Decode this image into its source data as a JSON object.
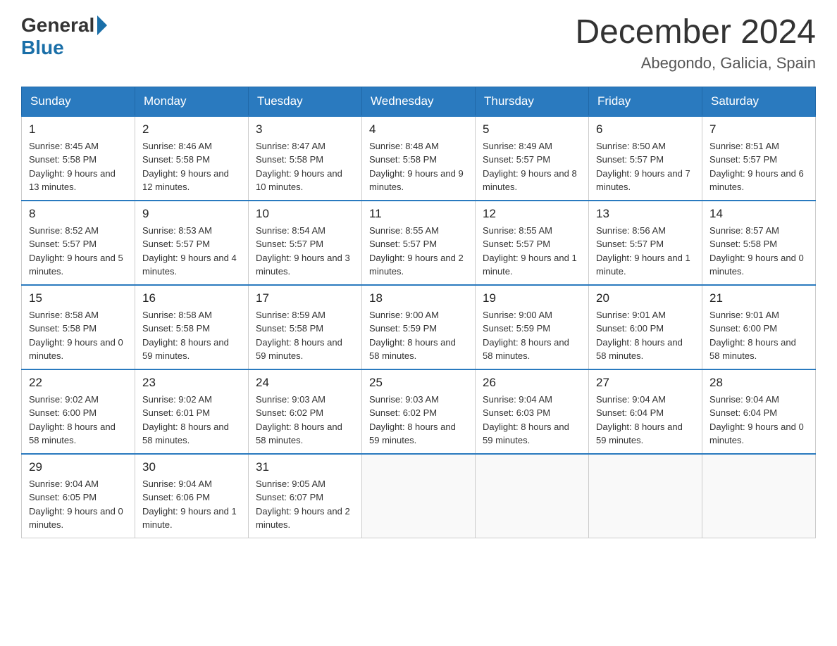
{
  "header": {
    "logo_general": "General",
    "logo_blue": "Blue",
    "month_title": "December 2024",
    "location": "Abegondo, Galicia, Spain"
  },
  "days_of_week": [
    "Sunday",
    "Monday",
    "Tuesday",
    "Wednesday",
    "Thursday",
    "Friday",
    "Saturday"
  ],
  "weeks": [
    [
      {
        "day": "1",
        "sunrise": "Sunrise: 8:45 AM",
        "sunset": "Sunset: 5:58 PM",
        "daylight": "Daylight: 9 hours and 13 minutes."
      },
      {
        "day": "2",
        "sunrise": "Sunrise: 8:46 AM",
        "sunset": "Sunset: 5:58 PM",
        "daylight": "Daylight: 9 hours and 12 minutes."
      },
      {
        "day": "3",
        "sunrise": "Sunrise: 8:47 AM",
        "sunset": "Sunset: 5:58 PM",
        "daylight": "Daylight: 9 hours and 10 minutes."
      },
      {
        "day": "4",
        "sunrise": "Sunrise: 8:48 AM",
        "sunset": "Sunset: 5:58 PM",
        "daylight": "Daylight: 9 hours and 9 minutes."
      },
      {
        "day": "5",
        "sunrise": "Sunrise: 8:49 AM",
        "sunset": "Sunset: 5:57 PM",
        "daylight": "Daylight: 9 hours and 8 minutes."
      },
      {
        "day": "6",
        "sunrise": "Sunrise: 8:50 AM",
        "sunset": "Sunset: 5:57 PM",
        "daylight": "Daylight: 9 hours and 7 minutes."
      },
      {
        "day": "7",
        "sunrise": "Sunrise: 8:51 AM",
        "sunset": "Sunset: 5:57 PM",
        "daylight": "Daylight: 9 hours and 6 minutes."
      }
    ],
    [
      {
        "day": "8",
        "sunrise": "Sunrise: 8:52 AM",
        "sunset": "Sunset: 5:57 PM",
        "daylight": "Daylight: 9 hours and 5 minutes."
      },
      {
        "day": "9",
        "sunrise": "Sunrise: 8:53 AM",
        "sunset": "Sunset: 5:57 PM",
        "daylight": "Daylight: 9 hours and 4 minutes."
      },
      {
        "day": "10",
        "sunrise": "Sunrise: 8:54 AM",
        "sunset": "Sunset: 5:57 PM",
        "daylight": "Daylight: 9 hours and 3 minutes."
      },
      {
        "day": "11",
        "sunrise": "Sunrise: 8:55 AM",
        "sunset": "Sunset: 5:57 PM",
        "daylight": "Daylight: 9 hours and 2 minutes."
      },
      {
        "day": "12",
        "sunrise": "Sunrise: 8:55 AM",
        "sunset": "Sunset: 5:57 PM",
        "daylight": "Daylight: 9 hours and 1 minute."
      },
      {
        "day": "13",
        "sunrise": "Sunrise: 8:56 AM",
        "sunset": "Sunset: 5:57 PM",
        "daylight": "Daylight: 9 hours and 1 minute."
      },
      {
        "day": "14",
        "sunrise": "Sunrise: 8:57 AM",
        "sunset": "Sunset: 5:58 PM",
        "daylight": "Daylight: 9 hours and 0 minutes."
      }
    ],
    [
      {
        "day": "15",
        "sunrise": "Sunrise: 8:58 AM",
        "sunset": "Sunset: 5:58 PM",
        "daylight": "Daylight: 9 hours and 0 minutes."
      },
      {
        "day": "16",
        "sunrise": "Sunrise: 8:58 AM",
        "sunset": "Sunset: 5:58 PM",
        "daylight": "Daylight: 8 hours and 59 minutes."
      },
      {
        "day": "17",
        "sunrise": "Sunrise: 8:59 AM",
        "sunset": "Sunset: 5:58 PM",
        "daylight": "Daylight: 8 hours and 59 minutes."
      },
      {
        "day": "18",
        "sunrise": "Sunrise: 9:00 AM",
        "sunset": "Sunset: 5:59 PM",
        "daylight": "Daylight: 8 hours and 58 minutes."
      },
      {
        "day": "19",
        "sunrise": "Sunrise: 9:00 AM",
        "sunset": "Sunset: 5:59 PM",
        "daylight": "Daylight: 8 hours and 58 minutes."
      },
      {
        "day": "20",
        "sunrise": "Sunrise: 9:01 AM",
        "sunset": "Sunset: 6:00 PM",
        "daylight": "Daylight: 8 hours and 58 minutes."
      },
      {
        "day": "21",
        "sunrise": "Sunrise: 9:01 AM",
        "sunset": "Sunset: 6:00 PM",
        "daylight": "Daylight: 8 hours and 58 minutes."
      }
    ],
    [
      {
        "day": "22",
        "sunrise": "Sunrise: 9:02 AM",
        "sunset": "Sunset: 6:00 PM",
        "daylight": "Daylight: 8 hours and 58 minutes."
      },
      {
        "day": "23",
        "sunrise": "Sunrise: 9:02 AM",
        "sunset": "Sunset: 6:01 PM",
        "daylight": "Daylight: 8 hours and 58 minutes."
      },
      {
        "day": "24",
        "sunrise": "Sunrise: 9:03 AM",
        "sunset": "Sunset: 6:02 PM",
        "daylight": "Daylight: 8 hours and 58 minutes."
      },
      {
        "day": "25",
        "sunrise": "Sunrise: 9:03 AM",
        "sunset": "Sunset: 6:02 PM",
        "daylight": "Daylight: 8 hours and 59 minutes."
      },
      {
        "day": "26",
        "sunrise": "Sunrise: 9:04 AM",
        "sunset": "Sunset: 6:03 PM",
        "daylight": "Daylight: 8 hours and 59 minutes."
      },
      {
        "day": "27",
        "sunrise": "Sunrise: 9:04 AM",
        "sunset": "Sunset: 6:04 PM",
        "daylight": "Daylight: 8 hours and 59 minutes."
      },
      {
        "day": "28",
        "sunrise": "Sunrise: 9:04 AM",
        "sunset": "Sunset: 6:04 PM",
        "daylight": "Daylight: 9 hours and 0 minutes."
      }
    ],
    [
      {
        "day": "29",
        "sunrise": "Sunrise: 9:04 AM",
        "sunset": "Sunset: 6:05 PM",
        "daylight": "Daylight: 9 hours and 0 minutes."
      },
      {
        "day": "30",
        "sunrise": "Sunrise: 9:04 AM",
        "sunset": "Sunset: 6:06 PM",
        "daylight": "Daylight: 9 hours and 1 minute."
      },
      {
        "day": "31",
        "sunrise": "Sunrise: 9:05 AM",
        "sunset": "Sunset: 6:07 PM",
        "daylight": "Daylight: 9 hours and 2 minutes."
      },
      {
        "day": "",
        "sunrise": "",
        "sunset": "",
        "daylight": ""
      },
      {
        "day": "",
        "sunrise": "",
        "sunset": "",
        "daylight": ""
      },
      {
        "day": "",
        "sunrise": "",
        "sunset": "",
        "daylight": ""
      },
      {
        "day": "",
        "sunrise": "",
        "sunset": "",
        "daylight": ""
      }
    ]
  ]
}
